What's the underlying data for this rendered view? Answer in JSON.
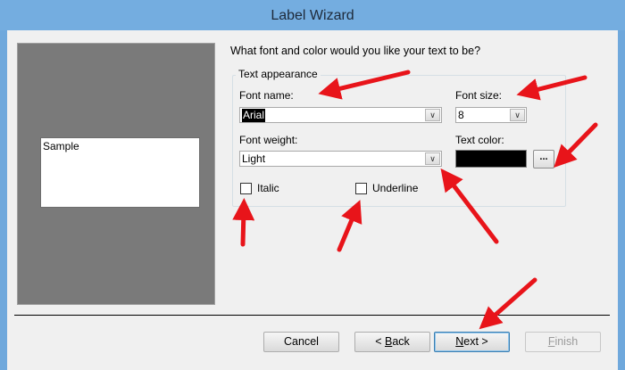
{
  "window": {
    "title": "Label Wizard",
    "titlebar_color": "#74ade0"
  },
  "preview": {
    "sample_text": "Sample"
  },
  "prompt": "What font and color would you like your text to be?",
  "group": {
    "legend": "Text appearance",
    "font_name_label": "Font name:",
    "font_name_value": "Arial",
    "font_size_label": "Font size:",
    "font_size_value": "8",
    "font_weight_label": "Font weight:",
    "font_weight_value": "Light",
    "text_color_label": "Text color:",
    "text_color_value": "#000000",
    "color_picker_label": "...",
    "italic_label": "Italic",
    "italic_checked": false,
    "underline_label": "Underline",
    "underline_checked": false
  },
  "buttons": {
    "cancel": "Cancel",
    "back_prefix": "< ",
    "back_hotkey": "B",
    "back_rest": "ack",
    "next_hotkey": "N",
    "next_rest": "ext >",
    "finish_hotkey": "F",
    "finish_rest": "inish"
  },
  "icons": {
    "dropdown": "chevron-down-icon",
    "annotation": "red-arrow-icon"
  },
  "colors": {
    "annotation_arrow": "#e8141a",
    "preview_bg": "#7a7a7a",
    "dialog_bg": "#f0f0f0"
  }
}
